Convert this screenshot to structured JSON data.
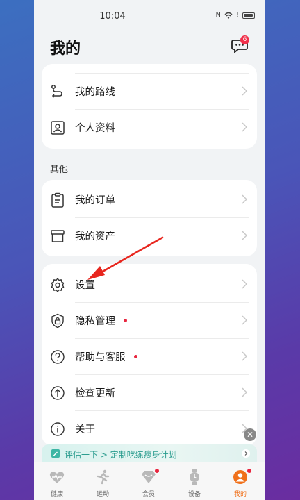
{
  "status": {
    "time": "10:04"
  },
  "header": {
    "title": "我的",
    "message_badge": "6"
  },
  "card1": {
    "items": [
      {
        "label": "我的路线",
        "icon": "route-icon"
      },
      {
        "label": "个人资料",
        "icon": "profile-icon"
      }
    ]
  },
  "section_other": {
    "label": "其他"
  },
  "card2": {
    "items": [
      {
        "label": "我的订单",
        "icon": "clipboard-icon"
      },
      {
        "label": "我的资产",
        "icon": "box-icon"
      }
    ]
  },
  "card3": {
    "items": [
      {
        "label": "设置",
        "icon": "gear-icon",
        "dot": false
      },
      {
        "label": "隐私管理",
        "icon": "privacy-lock-icon",
        "dot": true
      },
      {
        "label": "帮助与客服",
        "icon": "help-icon",
        "dot": true
      },
      {
        "label": "检查更新",
        "icon": "update-icon",
        "dot": false
      },
      {
        "label": "关于",
        "icon": "info-icon",
        "dot": false
      }
    ]
  },
  "promo": {
    "text": "评估一下 > 定制吃练瘦身计划"
  },
  "tabbar": {
    "tabs": [
      {
        "label": "健康",
        "icon": "heart-pulse-icon"
      },
      {
        "label": "运动",
        "icon": "run-icon"
      },
      {
        "label": "会员",
        "icon": "diamond-icon"
      },
      {
        "label": "设备",
        "icon": "watch-icon"
      },
      {
        "label": "我的",
        "icon": "avatar-icon"
      }
    ],
    "active": "我的"
  },
  "colors": {
    "accent": "#f0701a",
    "badge": "#f0304a",
    "annotation_arrow": "#e8261e",
    "promo_text": "#2a9c8e"
  }
}
